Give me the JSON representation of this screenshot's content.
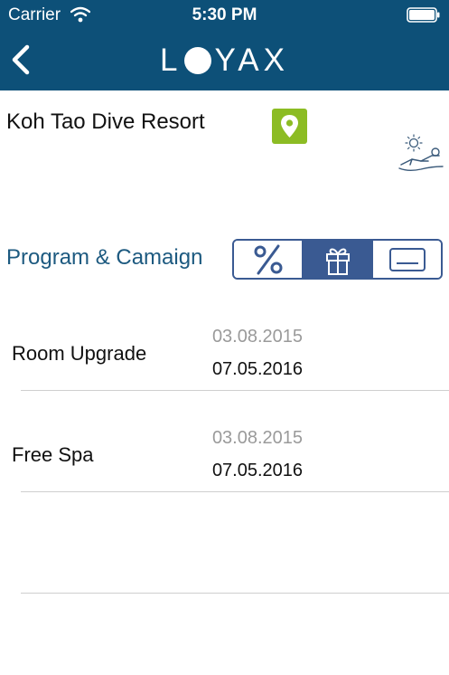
{
  "status_bar": {
    "carrier": "Carrier",
    "time": "5:30 PM"
  },
  "header": {
    "logo_left": "L",
    "logo_right": "YAX",
    "background_color": "#0d5078"
  },
  "resort": {
    "name": "Koh Tao Dive Resort",
    "pin_color": "#8cbc24"
  },
  "section": {
    "title": "Program & Camaign",
    "tabs": [
      {
        "icon": "percent-icon",
        "active": false
      },
      {
        "icon": "gift-icon",
        "active": true
      },
      {
        "icon": "card-icon",
        "active": false
      }
    ]
  },
  "items": [
    {
      "title": "Room Upgrade",
      "date_start": "03.08.2015",
      "date_end": "07.05.2016"
    },
    {
      "title": "Free Spa",
      "date_start": "03.08.2015",
      "date_end": "07.05.2016"
    }
  ]
}
